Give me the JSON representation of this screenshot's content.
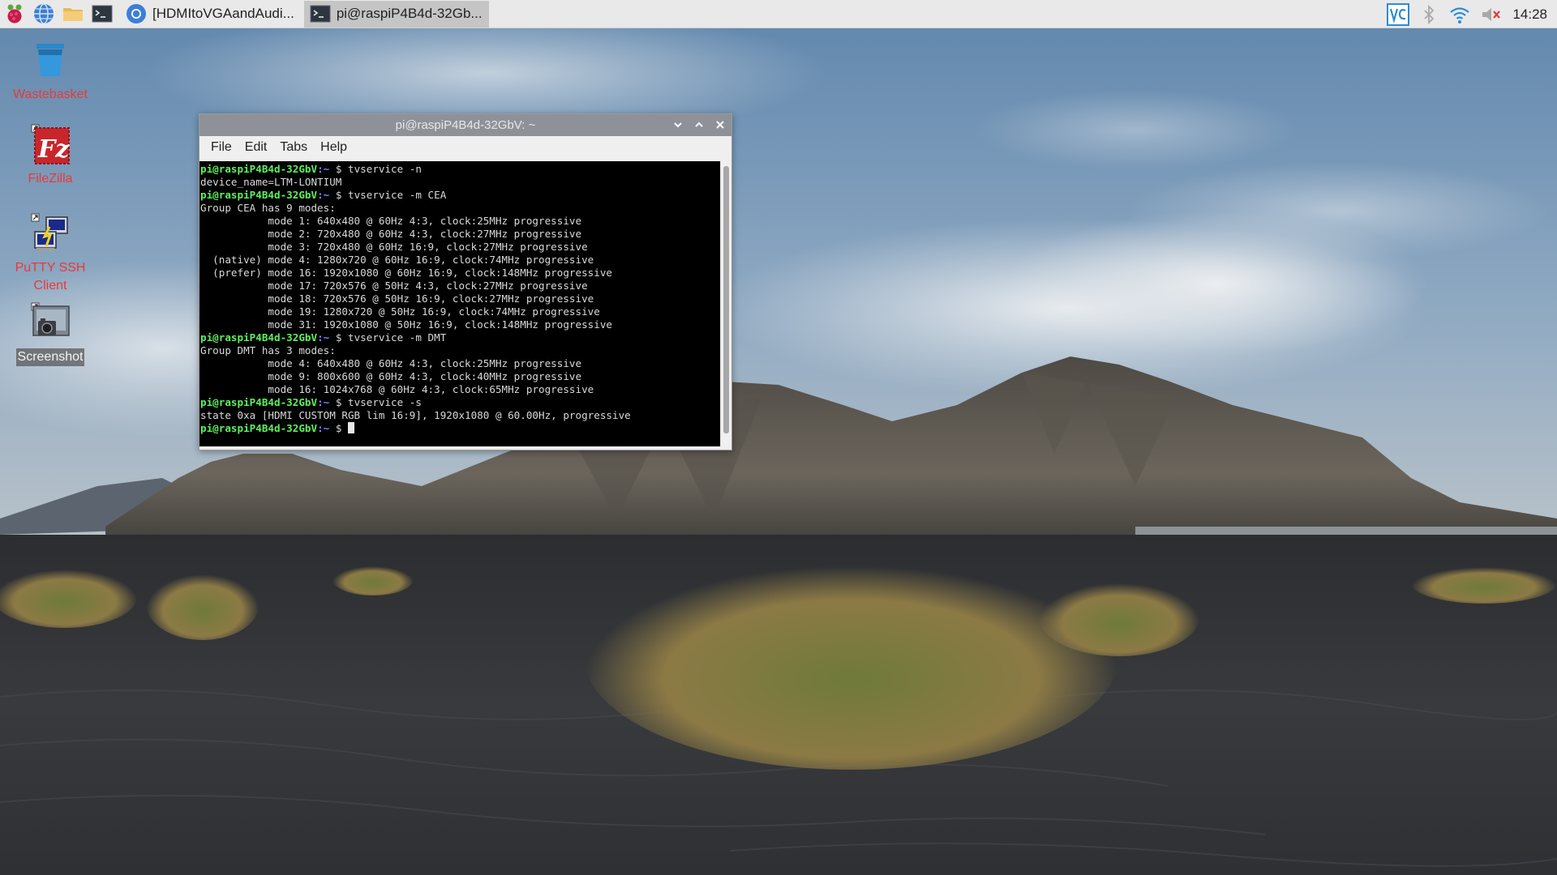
{
  "colors": {
    "prompt_user": "#5ef15e",
    "prompt_path": "#6a8cff",
    "terminal_bg": "#000000",
    "terminal_fg": "#d8d8d8",
    "panel_bg": "#e9e9e9",
    "desktop_label": "#e8393b"
  },
  "panel": {
    "launchers": [
      {
        "name": "raspberry-menu-icon"
      },
      {
        "name": "web-browser-icon"
      },
      {
        "name": "file-manager-icon"
      },
      {
        "name": "terminal-icon"
      }
    ],
    "tasks": [
      {
        "label": "[HDMItoVGAandAudi...",
        "icon": "chromium-icon",
        "active": false
      },
      {
        "label": "pi@raspiP4B4d-32Gb...",
        "icon": "terminal-icon",
        "active": true
      }
    ],
    "tray": [
      {
        "name": "vnc-icon"
      },
      {
        "name": "bluetooth-icon"
      },
      {
        "name": "wifi-icon"
      },
      {
        "name": "volume-muted-icon"
      }
    ],
    "clock": "14:28"
  },
  "desktop": {
    "icons": [
      {
        "label": "Wastebasket",
        "icon": "trash-icon"
      },
      {
        "label": "FileZilla",
        "icon": "filezilla-icon"
      },
      {
        "label": "PuTTY SSH Client",
        "icon": "putty-icon"
      },
      {
        "label": "Screenshot",
        "icon": "camera-icon",
        "selected": true
      }
    ]
  },
  "terminal": {
    "title": "pi@raspiP4B4d-32GbV: ~",
    "menu": [
      "File",
      "Edit",
      "Tabs",
      "Help"
    ],
    "prompt": {
      "user_host": "pi@raspiP4B4d-32GbV",
      "path": ":~",
      "symbol": " $ "
    },
    "lines": [
      {
        "type": "prompt",
        "cmd": "tvservice -n"
      },
      {
        "type": "out",
        "text": "device_name=LTM-LONTIUM"
      },
      {
        "type": "prompt",
        "cmd": "tvservice -m CEA"
      },
      {
        "type": "out",
        "text": "Group CEA has 9 modes:"
      },
      {
        "type": "out",
        "text": "           mode 1: 640x480 @ 60Hz 4:3, clock:25MHz progressive"
      },
      {
        "type": "out",
        "text": "           mode 2: 720x480 @ 60Hz 4:3, clock:27MHz progressive"
      },
      {
        "type": "out",
        "text": "           mode 3: 720x480 @ 60Hz 16:9, clock:27MHz progressive"
      },
      {
        "type": "out",
        "text": "  (native) mode 4: 1280x720 @ 60Hz 16:9, clock:74MHz progressive"
      },
      {
        "type": "out",
        "text": "  (prefer) mode 16: 1920x1080 @ 60Hz 16:9, clock:148MHz progressive"
      },
      {
        "type": "out",
        "text": "           mode 17: 720x576 @ 50Hz 4:3, clock:27MHz progressive"
      },
      {
        "type": "out",
        "text": "           mode 18: 720x576 @ 50Hz 16:9, clock:27MHz progressive"
      },
      {
        "type": "out",
        "text": "           mode 19: 1280x720 @ 50Hz 16:9, clock:74MHz progressive"
      },
      {
        "type": "out",
        "text": "           mode 31: 1920x1080 @ 50Hz 16:9, clock:148MHz progressive"
      },
      {
        "type": "prompt",
        "cmd": "tvservice -m DMT"
      },
      {
        "type": "out",
        "text": "Group DMT has 3 modes:"
      },
      {
        "type": "out",
        "text": "           mode 4: 640x480 @ 60Hz 4:3, clock:25MHz progressive"
      },
      {
        "type": "out",
        "text": "           mode 9: 800x600 @ 60Hz 4:3, clock:40MHz progressive"
      },
      {
        "type": "out",
        "text": "           mode 16: 1024x768 @ 60Hz 4:3, clock:65MHz progressive"
      },
      {
        "type": "prompt",
        "cmd": "tvservice -s"
      },
      {
        "type": "out",
        "text": "state 0xa [HDMI CUSTOM RGB lim 16:9], 1920x1080 @ 60.00Hz, progressive"
      },
      {
        "type": "prompt",
        "cmd": "",
        "cursor": true
      }
    ]
  }
}
